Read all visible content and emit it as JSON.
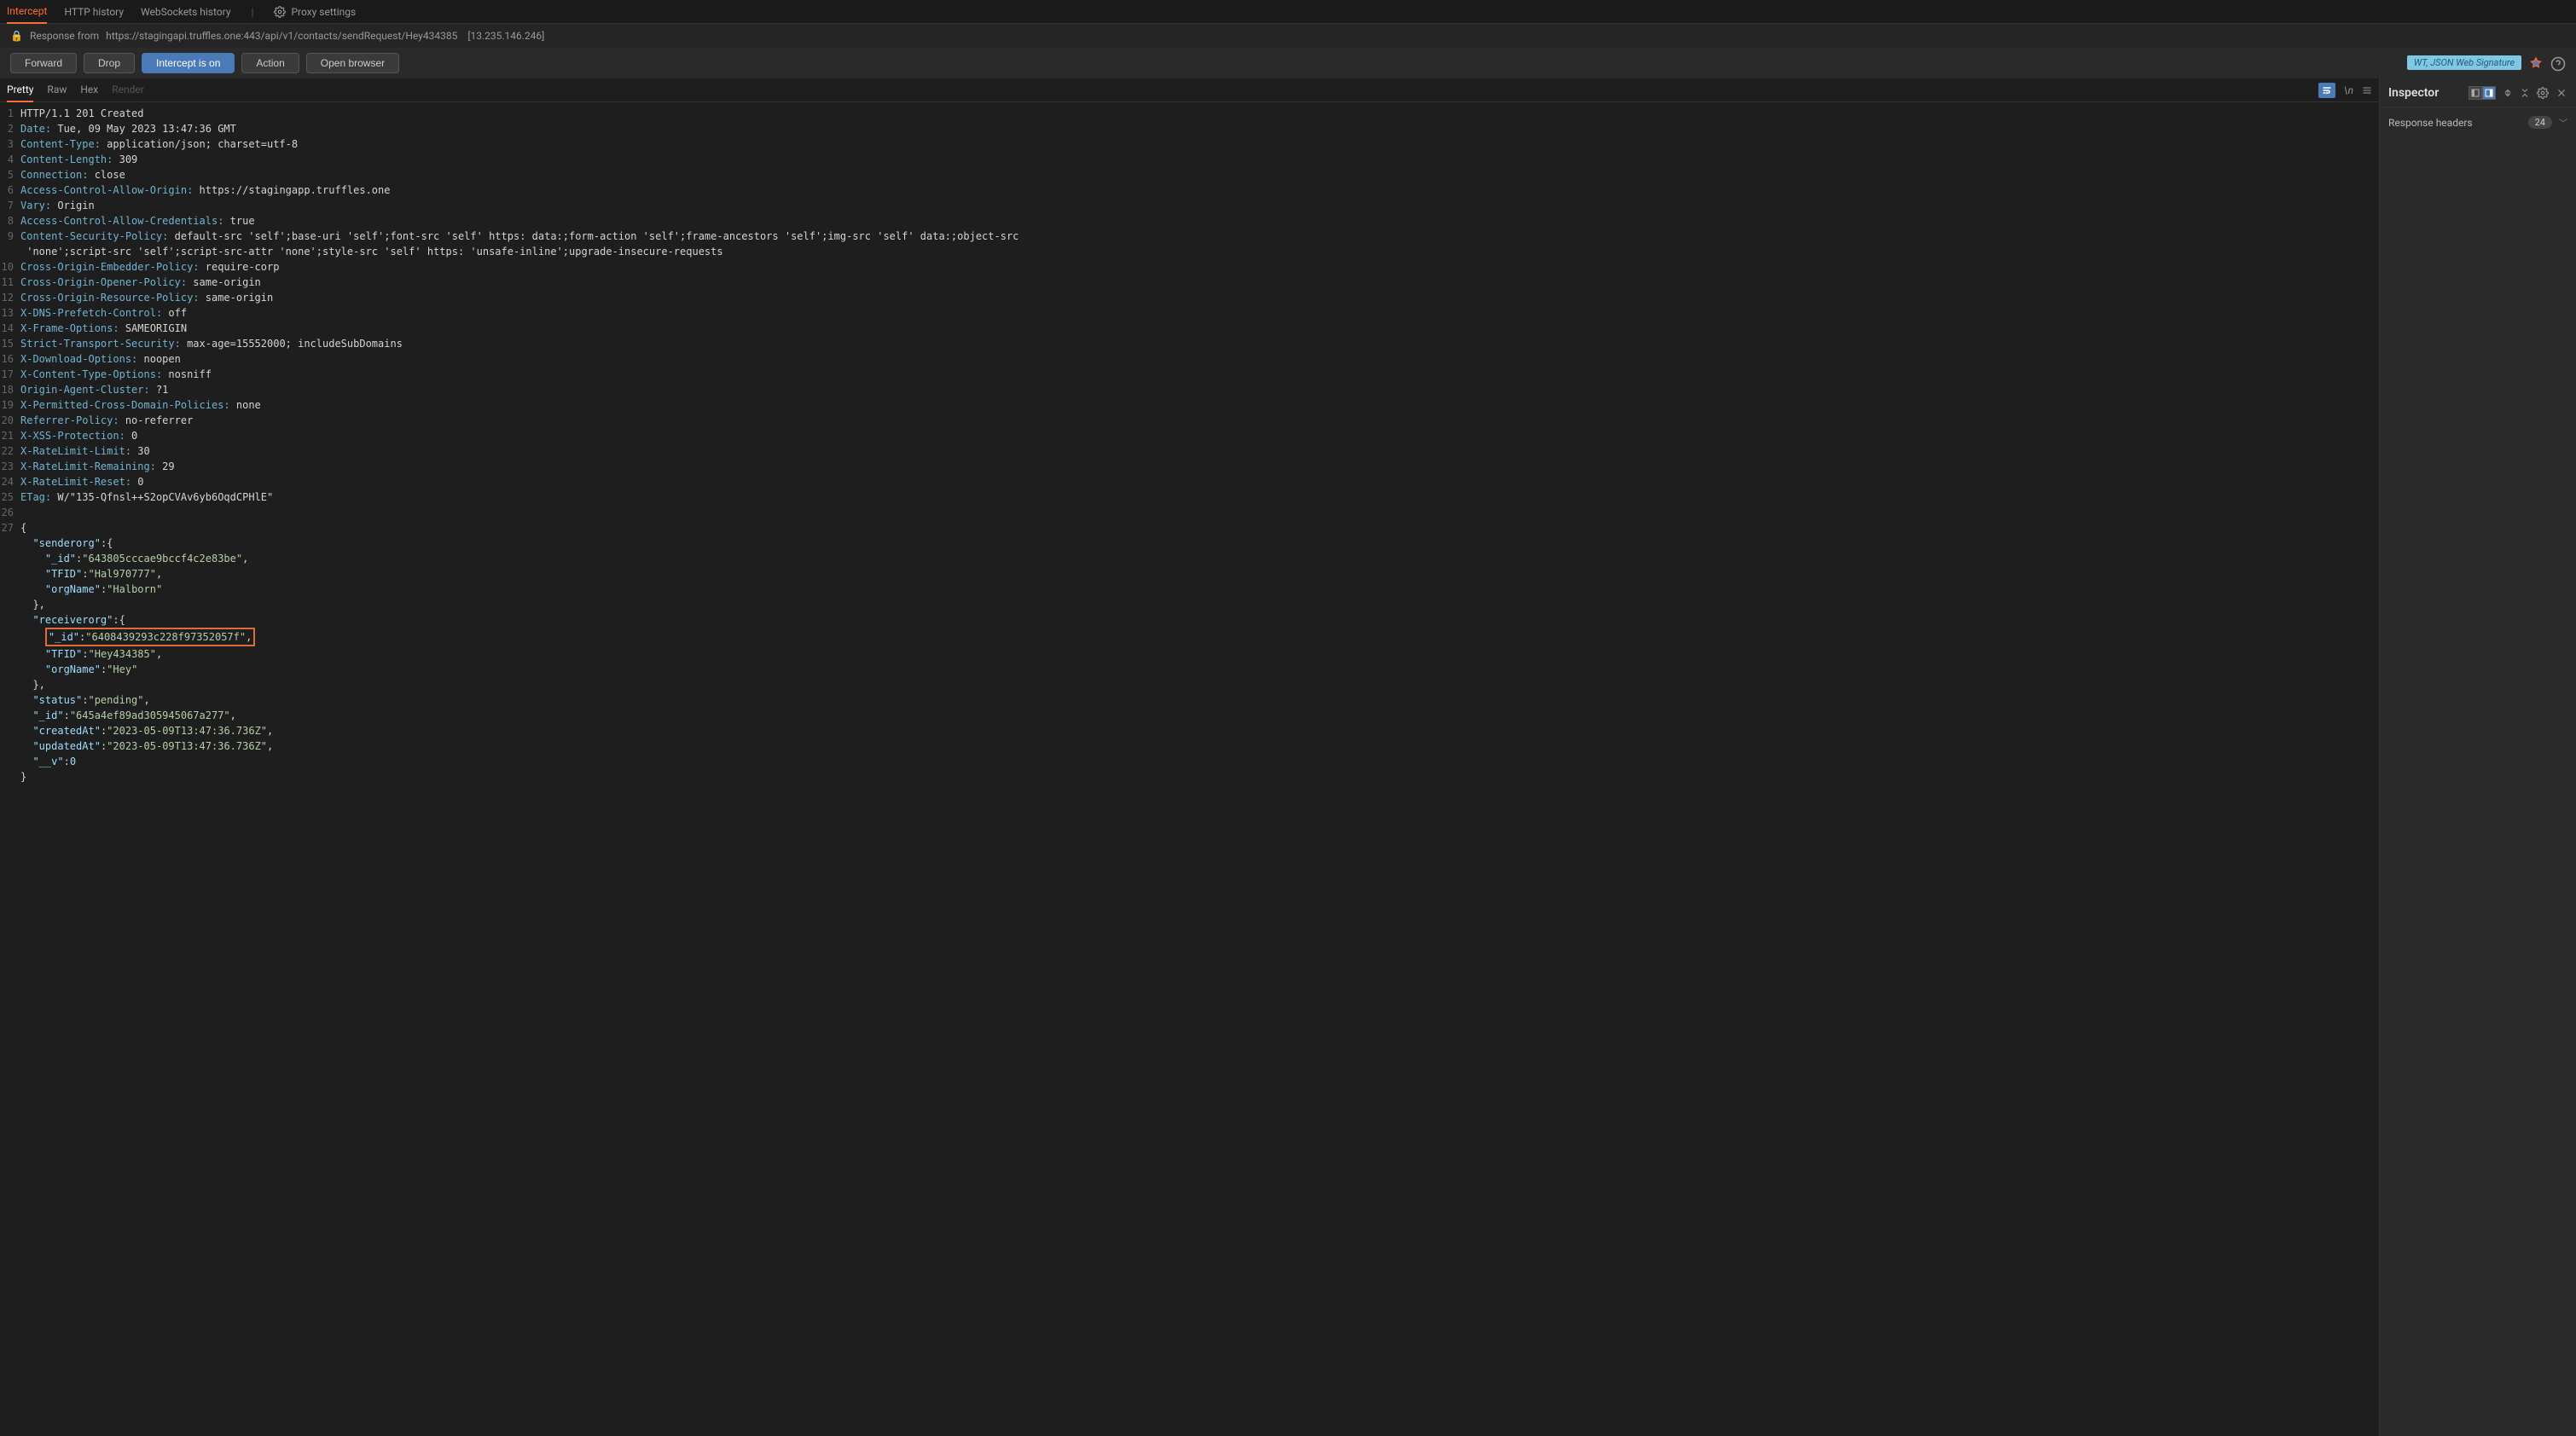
{
  "topTabs": {
    "intercept": "Intercept",
    "httpHistory": "HTTP history",
    "wsHistory": "WebSockets history",
    "proxySettings": "Proxy settings"
  },
  "infoBar": {
    "label": "Response from",
    "url": "https://stagingapi.truffles.one:443/api/v1/contacts/sendRequest/Hey434385",
    "ip": "[13.235.146.246]"
  },
  "buttons": {
    "forward": "Forward",
    "drop": "Drop",
    "intercept": "Intercept is on",
    "action": "Action",
    "openBrowser": "Open browser"
  },
  "jwtBadge": "WT, JSON Web Signature",
  "viewTabs": {
    "pretty": "Pretty",
    "raw": "Raw",
    "hex": "Hex",
    "render": "Render"
  },
  "code": [
    {
      "n": 1,
      "segs": [
        {
          "t": "HTTP/1.1 201 Created",
          "c": "hdr-val"
        }
      ]
    },
    {
      "n": 2,
      "segs": [
        {
          "t": "Date:",
          "c": "hdr-name"
        },
        {
          "t": " Tue, 09 May 2023 13:47:36 GMT",
          "c": "hdr-val"
        }
      ]
    },
    {
      "n": 3,
      "segs": [
        {
          "t": "Content-Type:",
          "c": "hdr-name"
        },
        {
          "t": " application/json; charset=utf-8",
          "c": "hdr-val"
        }
      ]
    },
    {
      "n": 4,
      "segs": [
        {
          "t": "Content-Length:",
          "c": "hdr-name"
        },
        {
          "t": " 309",
          "c": "hdr-val"
        }
      ]
    },
    {
      "n": 5,
      "segs": [
        {
          "t": "Connection:",
          "c": "hdr-name"
        },
        {
          "t": " close",
          "c": "hdr-val"
        }
      ]
    },
    {
      "n": 6,
      "segs": [
        {
          "t": "Access-Control-Allow-Origin:",
          "c": "hdr-name"
        },
        {
          "t": " https://stagingapp.truffles.one",
          "c": "hdr-val"
        }
      ]
    },
    {
      "n": 7,
      "segs": [
        {
          "t": "Vary:",
          "c": "hdr-name"
        },
        {
          "t": " Origin",
          "c": "hdr-val"
        }
      ]
    },
    {
      "n": 8,
      "segs": [
        {
          "t": "Access-Control-Allow-Credentials:",
          "c": "hdr-name"
        },
        {
          "t": " true",
          "c": "hdr-val"
        }
      ]
    },
    {
      "n": 9,
      "segs": [
        {
          "t": "Content-Security-Policy:",
          "c": "hdr-name"
        },
        {
          "t": " default-src 'self';base-uri 'self';font-src 'self' https: data:;form-action 'self';frame-ancestors 'self';img-src 'self' data:;object-src",
          "c": "hdr-val"
        }
      ]
    },
    {
      "n": null,
      "segs": [
        {
          "t": " 'none';script-src 'self';script-src-attr 'none';style-src 'self' https: 'unsafe-inline';upgrade-insecure-requests",
          "c": "hdr-val"
        }
      ]
    },
    {
      "n": 10,
      "segs": [
        {
          "t": "Cross-Origin-Embedder-Policy:",
          "c": "hdr-name"
        },
        {
          "t": " require-corp",
          "c": "hdr-val"
        }
      ]
    },
    {
      "n": 11,
      "segs": [
        {
          "t": "Cross-Origin-Opener-Policy:",
          "c": "hdr-name"
        },
        {
          "t": " same-origin",
          "c": "hdr-val"
        }
      ]
    },
    {
      "n": 12,
      "segs": [
        {
          "t": "Cross-Origin-Resource-Policy:",
          "c": "hdr-name"
        },
        {
          "t": " same-origin",
          "c": "hdr-val"
        }
      ]
    },
    {
      "n": 13,
      "segs": [
        {
          "t": "X-DNS-Prefetch-Control:",
          "c": "hdr-name"
        },
        {
          "t": " off",
          "c": "hdr-val"
        }
      ]
    },
    {
      "n": 14,
      "segs": [
        {
          "t": "X-Frame-Options:",
          "c": "hdr-name"
        },
        {
          "t": " SAMEORIGIN",
          "c": "hdr-val"
        }
      ]
    },
    {
      "n": 15,
      "segs": [
        {
          "t": "Strict-Transport-Security:",
          "c": "hdr-name"
        },
        {
          "t": " max-age=15552000; includeSubDomains",
          "c": "hdr-val"
        }
      ]
    },
    {
      "n": 16,
      "segs": [
        {
          "t": "X-Download-Options:",
          "c": "hdr-name"
        },
        {
          "t": " noopen",
          "c": "hdr-val"
        }
      ]
    },
    {
      "n": 17,
      "segs": [
        {
          "t": "X-Content-Type-Options:",
          "c": "hdr-name"
        },
        {
          "t": " nosniff",
          "c": "hdr-val"
        }
      ]
    },
    {
      "n": 18,
      "segs": [
        {
          "t": "Origin-Agent-Cluster:",
          "c": "hdr-name"
        },
        {
          "t": " ?1",
          "c": "hdr-val"
        }
      ]
    },
    {
      "n": 19,
      "segs": [
        {
          "t": "X-Permitted-Cross-Domain-Policies:",
          "c": "hdr-name"
        },
        {
          "t": " none",
          "c": "hdr-val"
        }
      ]
    },
    {
      "n": 20,
      "segs": [
        {
          "t": "Referrer-Policy:",
          "c": "hdr-name"
        },
        {
          "t": " no-referrer",
          "c": "hdr-val"
        }
      ]
    },
    {
      "n": 21,
      "segs": [
        {
          "t": "X-XSS-Protection:",
          "c": "hdr-name"
        },
        {
          "t": " 0",
          "c": "hdr-val"
        }
      ]
    },
    {
      "n": 22,
      "segs": [
        {
          "t": "X-RateLimit-Limit:",
          "c": "hdr-name"
        },
        {
          "t": " 30",
          "c": "hdr-val"
        }
      ]
    },
    {
      "n": 23,
      "segs": [
        {
          "t": "X-RateLimit-Remaining:",
          "c": "hdr-name"
        },
        {
          "t": " 29",
          "c": "hdr-val"
        }
      ]
    },
    {
      "n": 24,
      "segs": [
        {
          "t": "X-RateLimit-Reset:",
          "c": "hdr-name"
        },
        {
          "t": " 0",
          "c": "hdr-val"
        }
      ]
    },
    {
      "n": 25,
      "segs": [
        {
          "t": "ETag:",
          "c": "hdr-name"
        },
        {
          "t": " W/\"135-Qfnsl++S2opCVAv6yb6OqdCPHlE\"",
          "c": "hdr-val"
        }
      ]
    },
    {
      "n": 26,
      "segs": [
        {
          "t": "",
          "c": ""
        }
      ]
    },
    {
      "n": 27,
      "segs": [
        {
          "t": "{",
          "c": ""
        }
      ]
    },
    {
      "n": null,
      "segs": [
        {
          "t": "  ",
          "c": ""
        },
        {
          "t": "\"senderorg\"",
          "c": "json-key"
        },
        {
          "t": ":{",
          "c": ""
        }
      ]
    },
    {
      "n": null,
      "segs": [
        {
          "t": "    ",
          "c": ""
        },
        {
          "t": "\"_id\"",
          "c": "json-key"
        },
        {
          "t": ":",
          "c": ""
        },
        {
          "t": "\"643805cccae9bccf4c2e83be\"",
          "c": "json-str"
        },
        {
          "t": ",",
          "c": ""
        }
      ]
    },
    {
      "n": null,
      "segs": [
        {
          "t": "    ",
          "c": ""
        },
        {
          "t": "\"TFID\"",
          "c": "json-key"
        },
        {
          "t": ":",
          "c": ""
        },
        {
          "t": "\"Hal970777\"",
          "c": "json-str"
        },
        {
          "t": ",",
          "c": ""
        }
      ]
    },
    {
      "n": null,
      "segs": [
        {
          "t": "    ",
          "c": ""
        },
        {
          "t": "\"orgName\"",
          "c": "json-key"
        },
        {
          "t": ":",
          "c": ""
        },
        {
          "t": "\"Halborn\"",
          "c": "json-str"
        }
      ]
    },
    {
      "n": null,
      "segs": [
        {
          "t": "  },",
          "c": ""
        }
      ]
    },
    {
      "n": null,
      "segs": [
        {
          "t": "  ",
          "c": ""
        },
        {
          "t": "\"receiverorg\"",
          "c": "json-key"
        },
        {
          "t": ":{",
          "c": ""
        }
      ]
    },
    {
      "n": null,
      "hl": true,
      "segs": [
        {
          "t": "    ",
          "c": ""
        },
        {
          "t": "\"_id\"",
          "c": "json-key"
        },
        {
          "t": ":",
          "c": ""
        },
        {
          "t": "\"6408439293c228f97352057f\"",
          "c": "json-str"
        },
        {
          "t": ",",
          "c": ""
        }
      ]
    },
    {
      "n": null,
      "segs": [
        {
          "t": "    ",
          "c": ""
        },
        {
          "t": "\"TFID\"",
          "c": "json-key"
        },
        {
          "t": ":",
          "c": ""
        },
        {
          "t": "\"Hey434385\"",
          "c": "json-str"
        },
        {
          "t": ",",
          "c": ""
        }
      ]
    },
    {
      "n": null,
      "segs": [
        {
          "t": "    ",
          "c": ""
        },
        {
          "t": "\"orgName\"",
          "c": "json-key"
        },
        {
          "t": ":",
          "c": ""
        },
        {
          "t": "\"Hey\"",
          "c": "json-str"
        }
      ]
    },
    {
      "n": null,
      "segs": [
        {
          "t": "  },",
          "c": ""
        }
      ]
    },
    {
      "n": null,
      "segs": [
        {
          "t": "  ",
          "c": ""
        },
        {
          "t": "\"status\"",
          "c": "json-key"
        },
        {
          "t": ":",
          "c": ""
        },
        {
          "t": "\"pending\"",
          "c": "json-str"
        },
        {
          "t": ",",
          "c": ""
        }
      ]
    },
    {
      "n": null,
      "segs": [
        {
          "t": "  ",
          "c": ""
        },
        {
          "t": "\"_id\"",
          "c": "json-key"
        },
        {
          "t": ":",
          "c": ""
        },
        {
          "t": "\"645a4ef89ad305945067a277\"",
          "c": "json-str"
        },
        {
          "t": ",",
          "c": ""
        }
      ]
    },
    {
      "n": null,
      "segs": [
        {
          "t": "  ",
          "c": ""
        },
        {
          "t": "\"createdAt\"",
          "c": "json-key"
        },
        {
          "t": ":",
          "c": ""
        },
        {
          "t": "\"2023-05-09T13:47:36.736Z\"",
          "c": "json-str"
        },
        {
          "t": ",",
          "c": ""
        }
      ]
    },
    {
      "n": null,
      "segs": [
        {
          "t": "  ",
          "c": ""
        },
        {
          "t": "\"updatedAt\"",
          "c": "json-key"
        },
        {
          "t": ":",
          "c": ""
        },
        {
          "t": "\"2023-05-09T13:47:36.736Z\"",
          "c": "json-str"
        },
        {
          "t": ",",
          "c": ""
        }
      ]
    },
    {
      "n": null,
      "segs": [
        {
          "t": "  ",
          "c": ""
        },
        {
          "t": "\"__v\"",
          "c": "json-key"
        },
        {
          "t": ":",
          "c": ""
        },
        {
          "t": "0",
          "c": "json-num"
        }
      ]
    },
    {
      "n": null,
      "segs": [
        {
          "t": "}",
          "c": ""
        }
      ]
    }
  ],
  "inspector": {
    "title": "Inspector",
    "section": "Response headers",
    "count": "24"
  }
}
